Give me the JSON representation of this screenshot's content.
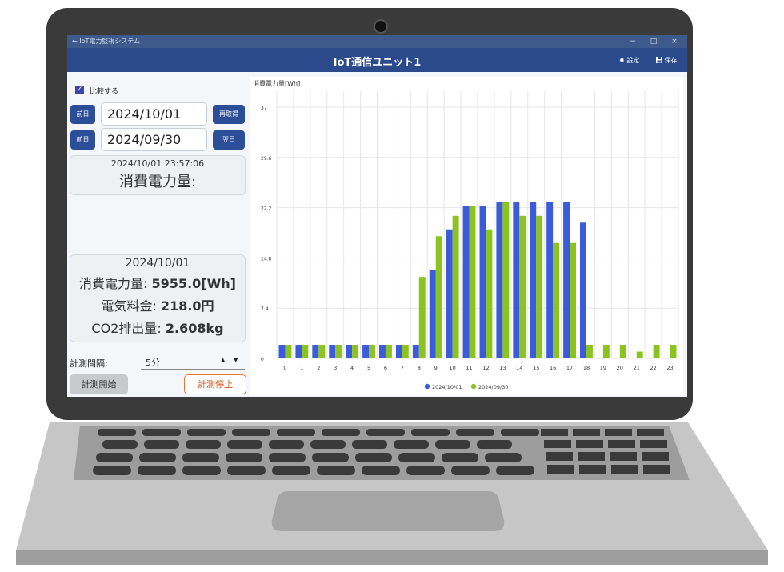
{
  "window": {
    "title": "IoT電力監視システム",
    "minimize": "−",
    "maximize": "□",
    "close": "×"
  },
  "header": {
    "title": "IoT通信ユニット1",
    "settings_label": "設定",
    "save_label": "保存"
  },
  "compare": {
    "checked": true,
    "label": "比較する"
  },
  "row1": {
    "prev_label": "前日",
    "date": "2024/10/01 (火)",
    "reload_label": "再取得"
  },
  "row2": {
    "prev_label": "前日",
    "date": "2024/09/30 (月)",
    "next_label": "翌日"
  },
  "current": {
    "timestamp": "2024/10/01 23:57:06",
    "label": "消費電力量:"
  },
  "summary": {
    "date": "2024/10/01",
    "power_label": "消費電力量: ",
    "power_value": "5955.0[Wh]",
    "fee_label": "電気料金: ",
    "fee_value": "218.0円",
    "co2_label": "CO2排出量: ",
    "co2_value": "2.608kg"
  },
  "interval": {
    "label": "計測間隔:",
    "value": "5分",
    "up": "▲",
    "down": "▼"
  },
  "buttons": {
    "start": "計測開始",
    "stop": "計測停止"
  },
  "colors": {
    "series1": "#3b5bdb",
    "series2": "#8cc320",
    "header": "#2b4a8c",
    "accent_orange": "#e07a2e"
  },
  "chart_data": {
    "type": "bar",
    "ylabel": "消費電力量[Wh]",
    "ylim": [
      0,
      37
    ],
    "yticks": [
      "0",
      "7.4",
      "14.8",
      "22.2",
      "29.6",
      "37"
    ],
    "categories": [
      "0",
      "1",
      "2",
      "3",
      "4",
      "5",
      "6",
      "7",
      "8",
      "9",
      "10",
      "11",
      "12",
      "13",
      "14",
      "15",
      "16",
      "17",
      "18",
      "19",
      "20",
      "21",
      "22",
      "23"
    ],
    "grid": true,
    "legend_position": "bottom",
    "series": [
      {
        "name": "2024/10/01",
        "color": "#3b5bdb",
        "values": [
          2,
          2,
          2,
          2,
          2,
          2,
          2,
          2,
          2,
          13,
          19,
          22.4,
          22.4,
          23,
          23,
          23,
          23,
          23,
          20,
          0,
          0,
          0,
          0,
          0
        ]
      },
      {
        "name": "2024/09/30",
        "color": "#8cc320",
        "values": [
          2,
          2,
          2,
          2,
          2,
          2,
          2,
          2,
          12,
          18,
          21,
          22.4,
          19,
          23,
          21,
          21,
          17,
          17,
          2,
          2,
          2,
          1,
          2,
          2
        ]
      }
    ]
  }
}
